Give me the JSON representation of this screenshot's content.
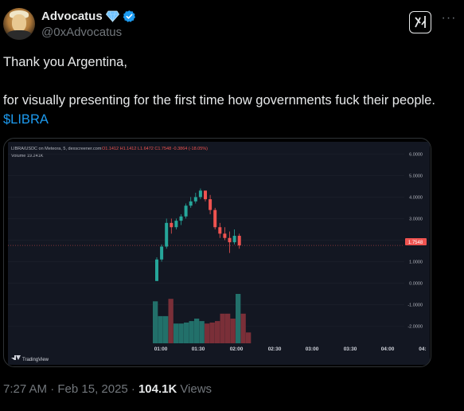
{
  "author": {
    "display_name": "Advocatus",
    "handle": "@0xAdvocatus",
    "badge_icon": "diamond-icon",
    "verified_icon": "verified-badge-icon"
  },
  "tweet": {
    "line1": "Thank you Argentina,",
    "line2_text": "for visually presenting for the first time how governments fuck their people.",
    "cashtag": "$LIBRA"
  },
  "chart": {
    "pair_header": "LIBRA/USDC on Meteora, 5, dexscreener.com",
    "ohlc_text": "O1.1412  H1.1412  L1.6472  C1.7548  -0.3864 (-18.05%)",
    "volume_text": "Volume 19.241K",
    "current_price_label": "1.7548",
    "watermark": "TradingView",
    "colors": {
      "up": "#26a69a",
      "down": "#ef5350",
      "bg": "#131722",
      "text": "#b2b5be"
    }
  },
  "chart_data": {
    "type": "candlestick",
    "x_ticks": [
      "01:00",
      "01:30",
      "02:00",
      "02:30",
      "03:00",
      "03:30",
      "04:00",
      "04:"
    ],
    "y_ticks": [
      "6.0000",
      "5.0000",
      "4.0000",
      "3.0000",
      "2.0000",
      "1.0000",
      "0.0000",
      "-1.0000",
      "-2.0000"
    ],
    "ylim": [
      -2.5,
      6.2
    ],
    "candles": [
      {
        "o": 0.1,
        "h": 1.2,
        "l": 0.1,
        "c": 1.1
      },
      {
        "o": 1.1,
        "h": 1.8,
        "l": 1.0,
        "c": 1.7
      },
      {
        "o": 1.7,
        "h": 3.0,
        "l": 1.6,
        "c": 2.8
      },
      {
        "o": 2.8,
        "h": 3.0,
        "l": 2.3,
        "c": 2.6
      },
      {
        "o": 2.6,
        "h": 3.0,
        "l": 2.5,
        "c": 2.9
      },
      {
        "o": 2.9,
        "h": 3.2,
        "l": 2.7,
        "c": 3.1
      },
      {
        "o": 3.1,
        "h": 3.7,
        "l": 3.0,
        "c": 3.6
      },
      {
        "o": 3.6,
        "h": 4.0,
        "l": 3.5,
        "c": 3.8
      },
      {
        "o": 3.8,
        "h": 4.2,
        "l": 3.7,
        "c": 4.0
      },
      {
        "o": 4.0,
        "h": 4.4,
        "l": 3.9,
        "c": 4.3
      },
      {
        "o": 4.3,
        "h": 4.3,
        "l": 3.8,
        "c": 3.9
      },
      {
        "o": 3.9,
        "h": 4.1,
        "l": 3.2,
        "c": 3.4
      },
      {
        "o": 3.4,
        "h": 3.5,
        "l": 2.5,
        "c": 2.6
      },
      {
        "o": 2.6,
        "h": 2.8,
        "l": 2.1,
        "c": 2.3
      },
      {
        "o": 2.3,
        "h": 2.6,
        "l": 2.0,
        "c": 2.1
      },
      {
        "o": 2.1,
        "h": 2.4,
        "l": 1.4,
        "c": 1.9
      },
      {
        "o": 1.9,
        "h": 2.5,
        "l": 1.8,
        "c": 2.2
      },
      {
        "o": 2.2,
        "h": 2.3,
        "l": 1.6,
        "c": 1.7548
      }
    ],
    "volume": [
      0.85,
      0.55,
      0.55,
      0.9,
      0.4,
      0.4,
      0.42,
      0.45,
      0.5,
      0.45,
      0.4,
      0.42,
      0.45,
      0.6,
      0.6,
      0.5,
      1.0,
      0.6,
      0.22
    ]
  },
  "footer": {
    "time": "7:27 AM · Feb 15, 2025 ·",
    "views_count": "104.1K",
    "views_label": "Views"
  }
}
